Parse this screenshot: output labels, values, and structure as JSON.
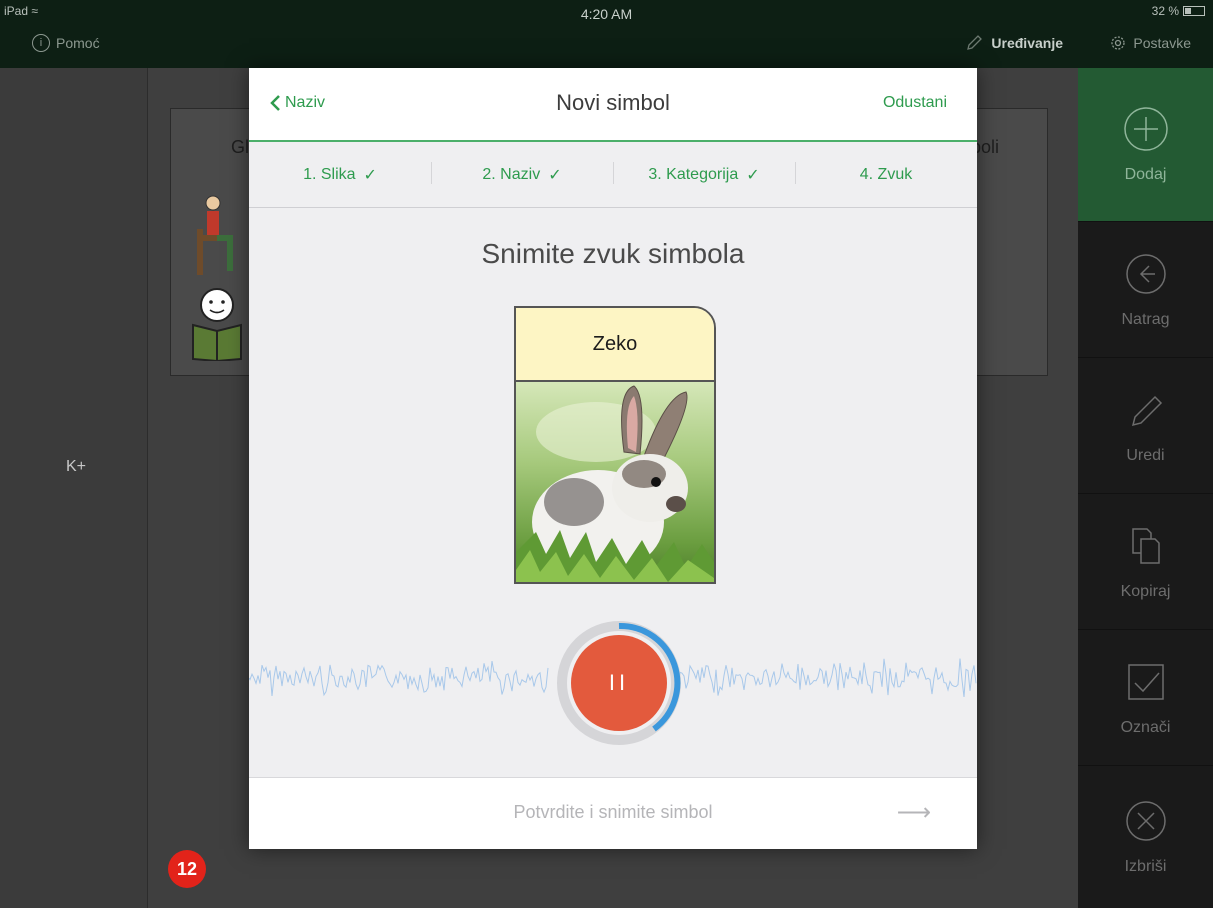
{
  "status_bar": {
    "carrier": "iPad",
    "time": "4:20 AM",
    "battery": "32 %"
  },
  "top_bar": {
    "help_label": "Pomoć",
    "editing_label": "Uređivanje",
    "settings_label": "Postavke"
  },
  "background": {
    "left_label": "K+",
    "card_left_title": "Gl",
    "card_right_title": "boli",
    "badge_count": "12"
  },
  "toolbar": {
    "items": [
      {
        "label": "Dodaj",
        "icon": "plus-circle-icon"
      },
      {
        "label": "Natrag",
        "icon": "arrow-left-circle-icon"
      },
      {
        "label": "Uredi",
        "icon": "pencil-icon"
      },
      {
        "label": "Kopiraj",
        "icon": "copy-icon"
      },
      {
        "label": "Označi",
        "icon": "checkbox-icon"
      },
      {
        "label": "Izbriši",
        "icon": "x-circle-icon"
      }
    ]
  },
  "modal": {
    "back_label": "Naziv",
    "title": "Novi simbol",
    "cancel_label": "Odustani",
    "steps": [
      {
        "label": "1. Slika",
        "done": "✓"
      },
      {
        "label": "2. Naziv",
        "done": "✓"
      },
      {
        "label": "3. Kategorija",
        "done": "✓"
      },
      {
        "label": "4. Zvuk",
        "done": ""
      }
    ],
    "prompt": "Snimite zvuk simbola",
    "symbol_label": "Zeko",
    "record_state": "II",
    "confirm_label": "Potvrdite i snimite simbol",
    "confirm_arrow": "⟶"
  },
  "colors": {
    "accent_green": "#2e9b4e",
    "record_red": "#e35a3d",
    "progress_blue": "#3a97dc",
    "badge_red": "#e2231a"
  }
}
